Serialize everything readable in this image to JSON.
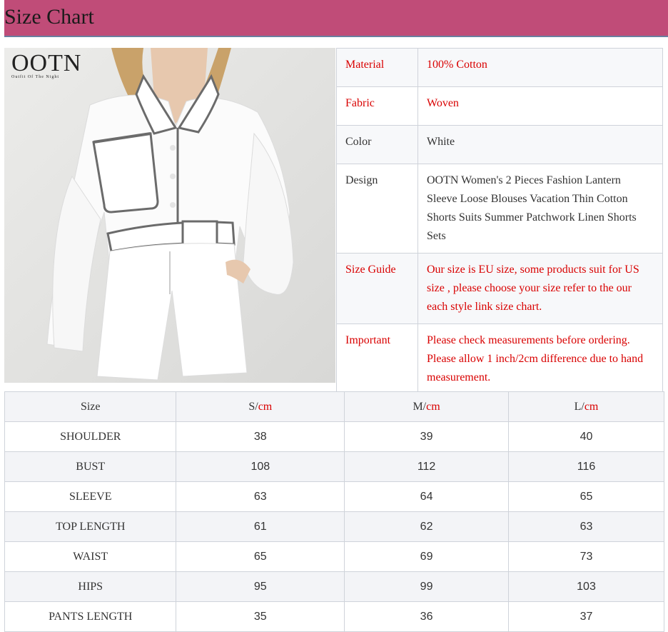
{
  "header": {
    "title": "Size Chart"
  },
  "logo": {
    "main": "OOTN",
    "sub": "Outfit Of The Night"
  },
  "info": [
    {
      "label": "Material",
      "value": "100% Cotton",
      "red": true
    },
    {
      "label": "Fabric",
      "value": "Woven",
      "red": true
    },
    {
      "label": "Color",
      "value": "White",
      "red": false
    },
    {
      "label": "Design",
      "value": "OOTN Women's 2 Pieces Fashion Lantern Sleeve Loose Blouses Vacation Thin Cotton Shorts Suits Summer Patchwork Linen Shorts Sets",
      "red": false
    },
    {
      "label": "Size Guide",
      "value": "Our size is EU size, some products suit for US size , please choose your size refer to the our each style link size chart.",
      "red": true
    },
    {
      "label": "Important",
      "value": "Please check measurements before ordering. Please allow 1 inch/2cm difference due to hand measurement.",
      "red": true
    }
  ],
  "sizes": {
    "header": [
      {
        "name": "Size",
        "unit": ""
      },
      {
        "name": "S/",
        "unit": "cm"
      },
      {
        "name": "M/",
        "unit": "cm"
      },
      {
        "name": "L/",
        "unit": "cm"
      }
    ],
    "rows": [
      {
        "label": "SHOULDER",
        "values": [
          "38",
          "39",
          "40"
        ]
      },
      {
        "label": "BUST",
        "values": [
          "108",
          "112",
          "116"
        ]
      },
      {
        "label": "SLEEVE",
        "values": [
          "63",
          "64",
          "65"
        ]
      },
      {
        "label": "TOP LENGTH",
        "values": [
          "61",
          "62",
          "63"
        ]
      },
      {
        "label": "WAIST",
        "values": [
          "65",
          "69",
          "73"
        ]
      },
      {
        "label": "HIPS",
        "values": [
          "95",
          "99",
          "103"
        ]
      },
      {
        "label": "PANTS LENGTH",
        "values": [
          "35",
          "36",
          "37"
        ]
      }
    ]
  }
}
